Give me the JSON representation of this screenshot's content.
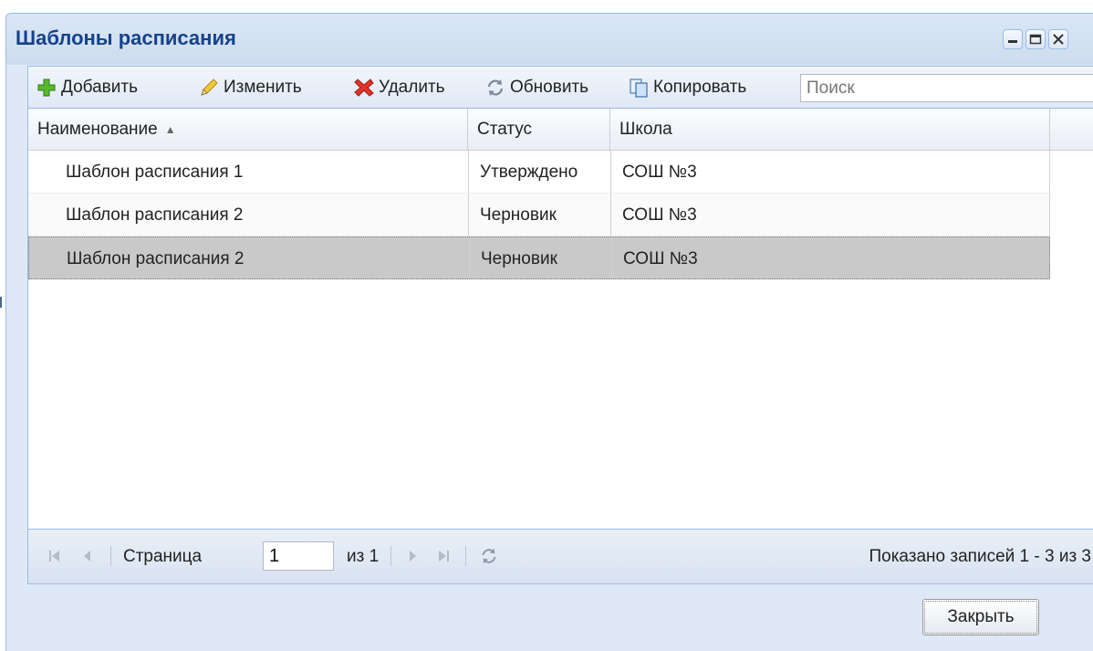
{
  "window": {
    "title": "Шаблоны расписания"
  },
  "toolbar": {
    "add_label": "Добавить",
    "edit_label": "Изменить",
    "delete_label": "Удалить",
    "refresh_label": "Обновить",
    "copy_label": "Копировать",
    "search_placeholder": "Поиск"
  },
  "grid": {
    "columns": [
      "Наименование",
      "Статус",
      "Школа"
    ],
    "sort_column": "Наименование",
    "sort_direction": "asc",
    "rows": [
      {
        "name": "Шаблон расписания 1",
        "status": "Утверждено",
        "school": "СОШ №3"
      },
      {
        "name": "Шаблон расписания 2",
        "status": "Черновик",
        "school": "СОШ №3"
      },
      {
        "name": "Шаблон расписания 2",
        "status": "Черновик",
        "school": "СОШ №3",
        "selected": true
      }
    ]
  },
  "pager": {
    "page_label": "Страница",
    "page_value": "1",
    "of_label": "из 1",
    "summary": "Показано записей 1 - 3 из 3"
  },
  "footer": {
    "close_label": "Закрыть"
  },
  "icons": {
    "add": "plus-icon",
    "edit": "pencil-icon",
    "delete": "red-x-icon",
    "refresh": "refresh-icon",
    "copy": "copy-icon"
  },
  "colors": {
    "title": "#15428b",
    "window_bg": "#dfe8f6",
    "border": "#99bbe8",
    "selected_row": "#c9c9c9"
  }
}
